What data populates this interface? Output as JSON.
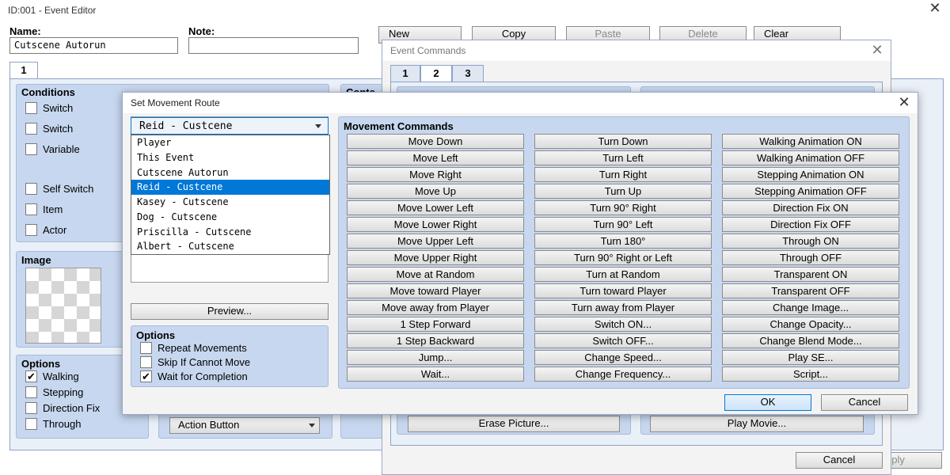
{
  "event_editor": {
    "title": "ID:001 - Event Editor",
    "name_label": "Name:",
    "name_value": "Cutscene Autorun",
    "note_label": "Note:",
    "note_value": "",
    "toolbar": {
      "new": "New",
      "copy": "Copy",
      "paste": "Paste",
      "delete": "Delete",
      "clear": "Clear"
    },
    "page_tab": "1",
    "conditions_title": "Conditions",
    "conditions": [
      {
        "label": "Switch",
        "checked": false
      },
      {
        "label": "Switch",
        "checked": false
      },
      {
        "label": "Variable",
        "checked": false
      },
      {
        "label": "Self Switch",
        "checked": false
      },
      {
        "label": "Item",
        "checked": false
      },
      {
        "label": "Actor",
        "checked": false
      }
    ],
    "contents_title_partial": "Conte",
    "image_title": "Image",
    "options_title": "Options",
    "options": [
      {
        "label": "Walking",
        "checked": true
      },
      {
        "label": "Stepping",
        "checked": false
      },
      {
        "label": "Direction Fix",
        "checked": false
      },
      {
        "label": "Through",
        "checked": false
      }
    ],
    "trigger_value": "Action Button",
    "apply_partial": "pply"
  },
  "event_commands": {
    "title": "Event Commands",
    "tabs": [
      "1",
      "2",
      "3"
    ],
    "selected_tab": "2",
    "erase_picture": "Erase Picture...",
    "play_movie": "Play Movie...",
    "cancel": "Cancel"
  },
  "movement_route": {
    "title": "Set Movement Route",
    "target_selected": "Reid - Custcene",
    "target_options": [
      "Player",
      "This Event",
      "Cutscene Autorun",
      "Reid - Custcene",
      "Kasey - Cutscene",
      "Dog - Cutscene",
      "Priscilla - Cutscene",
      "Albert - Cutscene"
    ],
    "highlighted_index": 3,
    "preview": "Preview...",
    "options_title": "Options",
    "options": [
      {
        "label": "Repeat Movements",
        "checked": false
      },
      {
        "label": "Skip If Cannot Move",
        "checked": false
      },
      {
        "label": "Wait for Completion",
        "checked": true
      }
    ],
    "commands_title": "Movement Commands",
    "commands": [
      [
        "Move Down",
        "Move Left",
        "Move Right",
        "Move Up",
        "Move Lower Left",
        "Move Lower Right",
        "Move Upper Left",
        "Move Upper Right",
        "Move at Random",
        "Move toward Player",
        "Move away from Player",
        "1 Step Forward",
        "1 Step Backward",
        "Jump...",
        "Wait..."
      ],
      [
        "Turn Down",
        "Turn Left",
        "Turn Right",
        "Turn Up",
        "Turn 90° Right",
        "Turn 90° Left",
        "Turn 180°",
        "Turn 90° Right or Left",
        "Turn at Random",
        "Turn toward Player",
        "Turn away from Player",
        "Switch ON...",
        "Switch OFF...",
        "Change Speed...",
        "Change Frequency..."
      ],
      [
        "Walking Animation ON",
        "Walking Animation OFF",
        "Stepping Animation ON",
        "Stepping Animation OFF",
        "Direction Fix ON",
        "Direction Fix OFF",
        "Through ON",
        "Through OFF",
        "Transparent ON",
        "Transparent OFF",
        "Change Image...",
        "Change Opacity...",
        "Change Blend Mode...",
        "Play SE...",
        "Script..."
      ]
    ],
    "ok": "OK",
    "cancel": "Cancel"
  }
}
